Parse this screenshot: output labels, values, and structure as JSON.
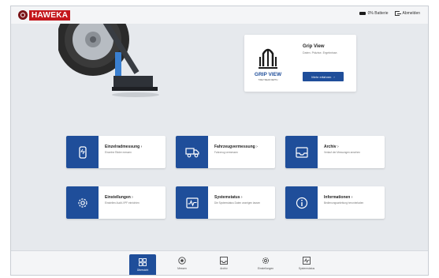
{
  "header": {
    "brand": "HAWEKA",
    "battery_label": "0% Batterie",
    "logout_label": "Abmelden"
  },
  "promo": {
    "product_name": "Grip View",
    "subtitle": "Daten. Präzise. Ergebnisse.",
    "logo_text": "GRIP VIEW",
    "logo_tagline": "TIRE TREAD DEPTH",
    "button_label": "Mehr erfahren"
  },
  "tiles": [
    {
      "title": "Einzelradmessung",
      "desc": "Einzelne Räder messen",
      "icon": "wheel-measure-icon"
    },
    {
      "title": "Fahrzeugvermessung",
      "desc": "Fahrzeug vermessen",
      "icon": "truck-icon"
    },
    {
      "title": "Archiv",
      "desc": "Verlauf der Messungen ansehen",
      "icon": "archive-icon"
    },
    {
      "title": "Einstellungen",
      "desc": "Einstellen Audit-VPF einrichten",
      "icon": "gear-icon"
    },
    {
      "title": "Systemstatus",
      "desc": "Die Systemstatus Daten anzeigen lassen",
      "icon": "system-status-icon"
    },
    {
      "title": "Informationen",
      "desc": "Bedienungsanleitung herunterladen",
      "icon": "info-icon"
    }
  ],
  "bottom_nav": [
    {
      "label": "Übersicht",
      "active": true,
      "icon": "grid-icon"
    },
    {
      "label": "Messen",
      "active": false,
      "icon": "tire-icon"
    },
    {
      "label": "Archiv",
      "active": false,
      "icon": "inbox-icon"
    },
    {
      "label": "Einstellungen",
      "active": false,
      "icon": "gear-icon"
    },
    {
      "label": "Systemstatus",
      "active": false,
      "icon": "status-icon"
    }
  ],
  "colors": {
    "accent": "#1f4e9a",
    "brand_red": "#c4161c",
    "background": "#e6e9ed"
  }
}
